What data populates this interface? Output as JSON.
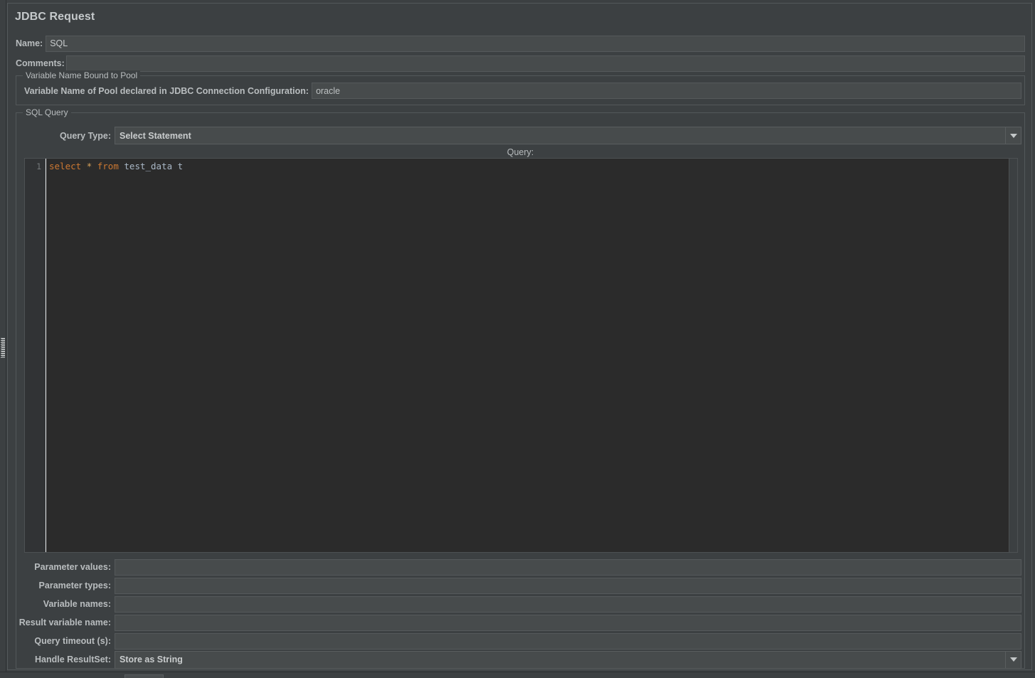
{
  "window": {
    "title": "JDBC Request"
  },
  "fields": {
    "name_label": "Name:",
    "name_value": "SQL",
    "comments_label": "Comments:",
    "comments_value": ""
  },
  "pool_group": {
    "title": "Variable Name Bound to Pool",
    "label": "Variable Name of Pool declared in JDBC Connection Configuration:",
    "value": "oracle"
  },
  "sql_group": {
    "title": "SQL Query",
    "query_type_label": "Query Type:",
    "query_type_value": "Select Statement",
    "query_label": "Query:"
  },
  "editor": {
    "line_number": "1",
    "tokens": {
      "kw_select": "select",
      "op_star": "*",
      "kw_from": "from",
      "id_table": "test_data",
      "id_alias": "t"
    },
    "full_text": "select * from test_data t"
  },
  "bottom_fields": [
    {
      "label": "Parameter values:",
      "value": ""
    },
    {
      "label": "Parameter types:",
      "value": ""
    },
    {
      "label": "Variable names:",
      "value": ""
    },
    {
      "label": "Result variable name:",
      "value": ""
    },
    {
      "label": "Query timeout (s):",
      "value": ""
    }
  ],
  "handle_resultset": {
    "label": "Handle ResultSet:",
    "value": "Store as String"
  },
  "icons": {
    "dropdown_arrow": "chevron-down-icon",
    "splitter_grip": "splitter-grip-icon"
  },
  "colors": {
    "panel_bg": "#3c4042",
    "field_bg": "#474b4c",
    "editor_bg": "#2b2b2b",
    "gutter_bg": "#313335",
    "label_fg": "#b9bdbf",
    "keyword": "#cc7832",
    "identifier": "#a9b7c6",
    "caret": "#e8ebec"
  }
}
